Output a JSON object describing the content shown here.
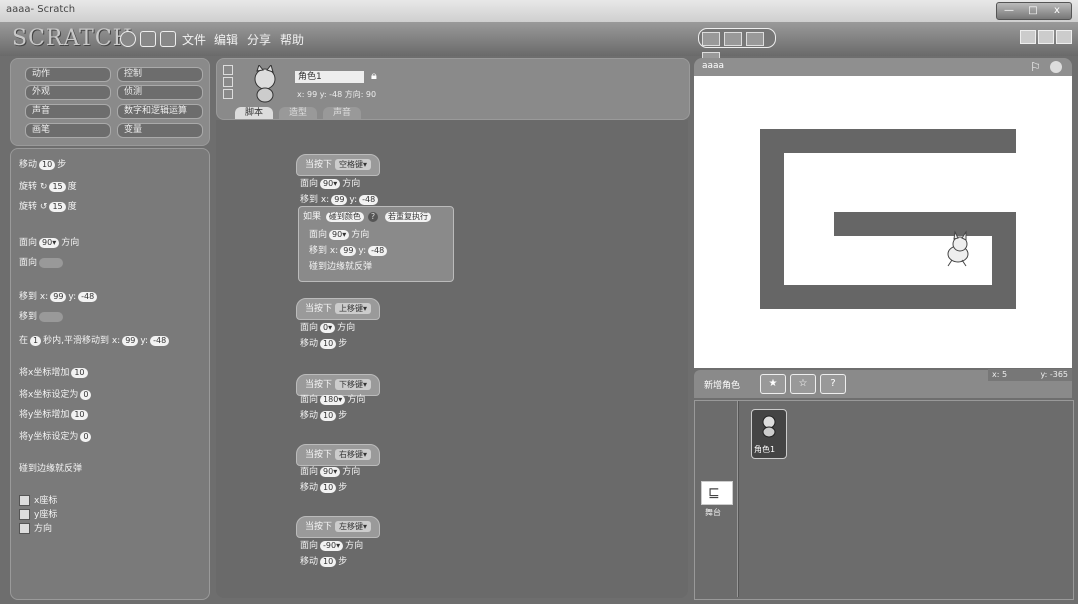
{
  "window": {
    "title": "aaaa- Scratch",
    "controls": [
      "—",
      "□",
      "x"
    ]
  },
  "toolbar": {
    "logo": "SCRATCH",
    "menus": [
      "文件",
      "编辑",
      "分享",
      "帮助"
    ]
  },
  "categories": [
    "动作",
    "控制",
    "外观",
    "侦测",
    "声音",
    "数字和逻辑运算",
    "画笔",
    "变量"
  ],
  "palette": {
    "move": [
      "移动",
      "10",
      "步"
    ],
    "turn_right": [
      "旋转",
      "15",
      "度"
    ],
    "turn_left": [
      "旋转",
      "15",
      "度"
    ],
    "point_dir": [
      "面向",
      "90▾",
      "方向"
    ],
    "point_towards": "面向",
    "goto_xy": [
      "移到 x:",
      "99",
      "y:",
      "-48"
    ],
    "goto": "移到",
    "glide": [
      "在",
      "1",
      "秒内,平滑移动到 x:",
      "99",
      "y:",
      "-48"
    ],
    "change_x": [
      "将x坐标增加",
      "10"
    ],
    "set_x": [
      "将x坐标设定为",
      "0"
    ],
    "change_y": [
      "将y坐标增加",
      "10"
    ],
    "set_y": [
      "将y坐标设定为",
      "0"
    ],
    "bounce": "碰到边缘就反弹",
    "reporters": [
      "x座标",
      "y座标",
      "方向"
    ]
  },
  "sprite": {
    "name": "角色1",
    "info": "x: 99   y: -48   方向: 90",
    "tabs": [
      "脚本",
      "造型",
      "声音"
    ]
  },
  "scripts": {
    "s1": {
      "hat": [
        "当按下",
        "空格键▾"
      ],
      "l1": [
        "面向",
        "90▾",
        "方向"
      ],
      "l2": [
        "移到 x:",
        "99",
        "y:",
        "-48"
      ],
      "if": [
        "如果",
        "碰到颜色",
        "?",
        "若重复执行"
      ],
      "i1": [
        "面向",
        "90▾",
        "方向"
      ],
      "i2": [
        "移到 x:",
        "99",
        "y:",
        "-48"
      ],
      "i3": "碰到边缘就反弹"
    },
    "s2": {
      "hat": [
        "当按下",
        "上移键▾"
      ],
      "l1": [
        "面向",
        "0▾",
        "方向"
      ],
      "l2": [
        "移动",
        "10",
        "步"
      ]
    },
    "s3": {
      "hat": [
        "当按下",
        "下移键▾"
      ],
      "l1": [
        "面向",
        "180▾",
        "方向"
      ],
      "l2": [
        "移动",
        "10",
        "步"
      ]
    },
    "s4": {
      "hat": [
        "当按下",
        "右移键▾"
      ],
      "l1": [
        "面向",
        "90▾",
        "方向"
      ],
      "l2": [
        "移动",
        "10",
        "步"
      ]
    },
    "s5": {
      "hat": [
        "当按下",
        "左移键▾"
      ],
      "l1": [
        "面向",
        "-90▾",
        "方向"
      ],
      "l2": [
        "移动",
        "10",
        "步"
      ]
    }
  },
  "stage": {
    "title": "aaaa",
    "x_readout": "x: 5",
    "y_readout": "y: -365"
  },
  "sprite_list": {
    "new_label": "新增角色",
    "sprite1": "角色1",
    "stage": "舞台"
  }
}
